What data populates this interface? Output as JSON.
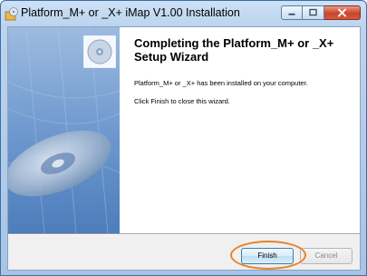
{
  "window": {
    "title": "Platform_M+ or _X+ iMap V1.00 Installation",
    "icons": {
      "app": "installer-icon",
      "minimize": "minimize-icon",
      "maximize": "maximize-icon",
      "close": "close-icon"
    }
  },
  "wizard": {
    "heading": "Completing the Platform_M+ or _X+ Setup Wizard",
    "installed_text": "Platform_M+ or _X+ has been installed on your computer.",
    "close_text": "Click Finish to close this wizard.",
    "side_images": [
      "cd-icon",
      "cd-disc-graphic"
    ]
  },
  "buttons": {
    "finish_label": "Finish",
    "cancel_label": "Cancel"
  },
  "colors": {
    "panel_blue": "#7ea6d6",
    "highlight": "#e8822a"
  }
}
